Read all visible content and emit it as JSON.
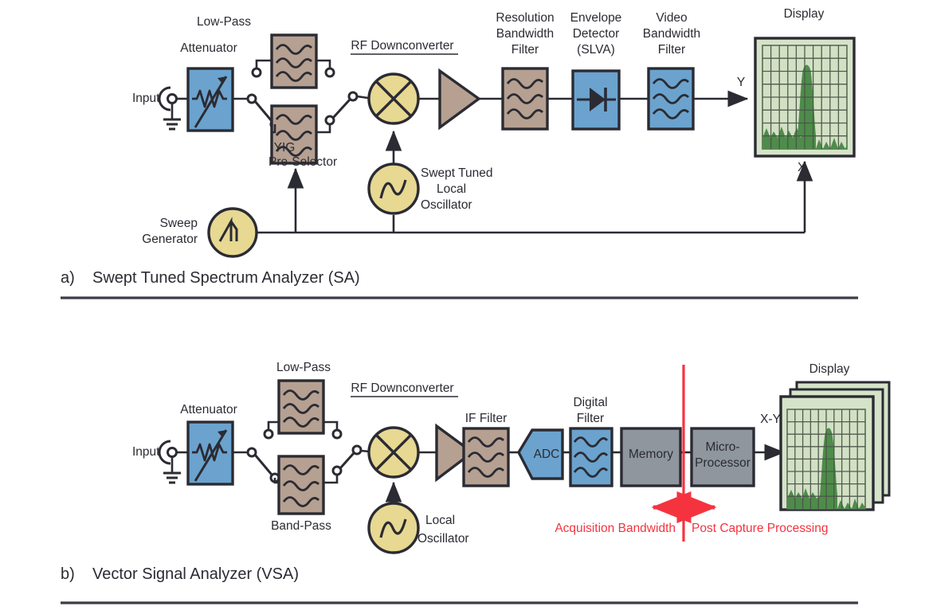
{
  "figure": {
    "panel_a": {
      "caption_marker": "a)",
      "caption": "Swept Tuned Spectrum Analyzer (SA)",
      "labels": {
        "input": "Input",
        "attenuator": "Attenuator",
        "low_pass": "Low-Pass",
        "yig": "YIG",
        "yig2": "Pre-Selector",
        "rf_downconverter": "RF Downconverter",
        "rbw1": "Resolution",
        "rbw2": "Bandwidth",
        "rbw3": "Filter",
        "env1": "Envelope",
        "env2": "Detector",
        "env3": "(SLVA)",
        "vbw1": "Video",
        "vbw2": "Bandwidth",
        "vbw3": "Filter",
        "display": "Display",
        "axis_y": "Y",
        "axis_x": "X",
        "slo1": "Swept Tuned",
        "slo2": "Local",
        "slo3": "Oscillator",
        "sweep1": "Sweep",
        "sweep2": "Generator"
      }
    },
    "panel_b": {
      "caption_marker": "b)",
      "caption": "Vector Signal Analyzer (VSA)",
      "labels": {
        "input": "Input",
        "attenuator": "Attenuator",
        "low_pass": "Low-Pass",
        "band_pass": "Band-Pass",
        "rf_downconverter": "RF Downconverter",
        "if_filter": "IF Filter",
        "adc": "ADC",
        "digital1": "Digital",
        "digital2": "Filter",
        "memory": "Memory",
        "micro1": "Micro-",
        "micro2": "Processor",
        "display": "Display",
        "axis_xy": "X-Y",
        "lo1": "Local",
        "lo2": "Oscillator",
        "acquisition_bandwidth": "Acquisition Bandwidth",
        "post_capture": "Post Capture Processing"
      }
    },
    "colors": {
      "blue_block": "#6BA3CE",
      "tan_block": "#B5A091",
      "yellow_circle": "#E7D892",
      "gray_block": "#8F969D",
      "display_frame": "#D5E3C8",
      "display_face": "#D2E0C4",
      "trace_green": "#4E8C4A",
      "outline": "#2b2b33",
      "red_accent": "#f5333f"
    }
  }
}
